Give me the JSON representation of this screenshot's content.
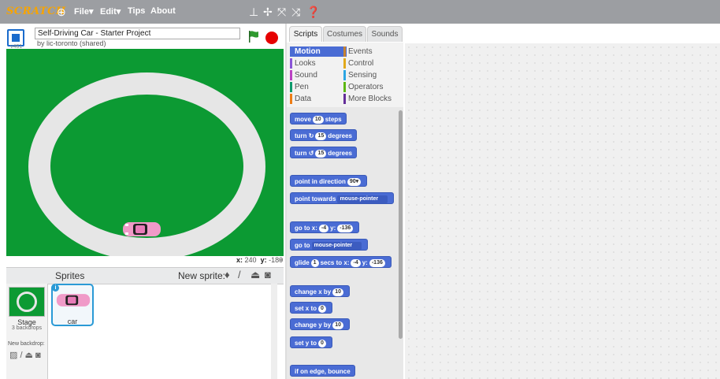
{
  "menubar": {
    "logo": "SCRATCH",
    "items": [
      "File▾",
      "Edit▾",
      "Tips",
      "About"
    ],
    "tool_icons": [
      "duplicate-icon",
      "delete-icon",
      "grow-icon",
      "shrink-icon",
      "help-icon"
    ]
  },
  "stage_header": {
    "version": "v461",
    "project_title": "Self-Driving Car - Starter Project",
    "author": "by lic-toronto (shared)"
  },
  "stage": {
    "background_color": "#0c9a33",
    "track_color": "#e6e6e6",
    "car_color": "#f09ac8"
  },
  "coords": {
    "x_label": "x:",
    "x": "240",
    "y_label": "y:",
    "y": "-180"
  },
  "sprites_pane": {
    "title": "Sprites",
    "new_sprite_label": "New sprite:",
    "stage_label": "Stage",
    "backdrops_count": "3 backdrops",
    "new_backdrop_label": "New backdrop:",
    "sprites": [
      {
        "name": "car",
        "selected": true
      }
    ]
  },
  "tabs": [
    "Scripts",
    "Costumes",
    "Sounds"
  ],
  "active_tab": "Scripts",
  "categories": [
    {
      "label": "Motion",
      "color": "#4a6cd4",
      "active": true
    },
    {
      "label": "Events",
      "color": "#c88330"
    },
    {
      "label": "Looks",
      "color": "#8a55d7"
    },
    {
      "label": "Control",
      "color": "#e1a91a"
    },
    {
      "label": "Sound",
      "color": "#bb42c3"
    },
    {
      "label": "Sensing",
      "color": "#2ca5e2"
    },
    {
      "label": "Pen",
      "color": "#0e9a6c"
    },
    {
      "label": "Operators",
      "color": "#5cb712"
    },
    {
      "label": "Data",
      "color": "#ee7d16"
    },
    {
      "label": "More Blocks",
      "color": "#632d99"
    }
  ],
  "blocks": {
    "move": {
      "pre": "move",
      "input": "10",
      "post": "steps"
    },
    "turn_right": {
      "pre": "turn ↻",
      "input": "15",
      "post": "degrees"
    },
    "turn_left": {
      "pre": "turn ↺",
      "input": "15",
      "post": "degrees"
    },
    "point_direction": {
      "pre": "point in direction",
      "input": "90▾"
    },
    "point_towards": {
      "pre": "point towards",
      "input": "mouse-pointer"
    },
    "go_to_xy": {
      "pre": "go to x:",
      "x": "-4",
      "mid": "y:",
      "y": "-136"
    },
    "go_to": {
      "pre": "go to",
      "input": "mouse-pointer"
    },
    "glide": {
      "pre": "glide",
      "secs": "1",
      "mid1": "secs to x:",
      "x": "-4",
      "mid2": "y:",
      "y": "-136"
    },
    "change_x": {
      "pre": "change x by",
      "input": "10"
    },
    "set_x": {
      "pre": "set x to",
      "input": "0"
    },
    "change_y": {
      "pre": "change y by",
      "input": "10"
    },
    "set_y": {
      "pre": "set y to",
      "input": "0"
    },
    "bounce": {
      "pre": "if on edge, bounce"
    }
  }
}
